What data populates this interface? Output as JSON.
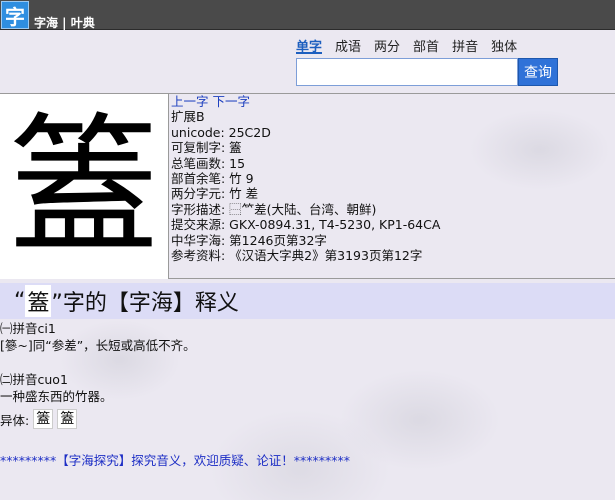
{
  "header": {
    "logo_glyph": "字",
    "site_name": "字海 | 叶典"
  },
  "search": {
    "tabs": [
      "单字",
      "成语",
      "两分",
      "部首",
      "拼音",
      "独体"
    ],
    "active_tab": "单字",
    "input_value": "",
    "button_label": "查询"
  },
  "glyph": {
    "character": "篕",
    "nav_prev": "上一字",
    "nav_next": "下一字",
    "lines": [
      "扩展B",
      "unicode: 25C2D",
      "可复制字: 篕",
      "总笔画数: 15",
      "部首余笔: 竹 9",
      "两分字元: 竹 差",
      "字形描述: ⿱⺮差(大陆、台湾、朝鲜)",
      "提交来源: GKX-0894.31, T4-5230, KP1-64CA",
      "中华字海: 第1246页第32字",
      "参考资料: 《汉语大字典2》第3193页第12字"
    ]
  },
  "definition": {
    "heading_prefix": "“",
    "heading_char": "篕",
    "heading_suffix": "”字的【字海】释义",
    "paras": [
      "㈠拼音ci1",
      "[篸~]同“参差”，长短或高低不齐。",
      "",
      "㈡拼音cuo1",
      "一种盛东西的竹器。"
    ],
    "variants_label": "异体:",
    "variants": [
      "篕",
      "篕"
    ]
  },
  "footer": {
    "text": "*********【字海探究】探究音义，欢迎质疑、论证！*********"
  }
}
